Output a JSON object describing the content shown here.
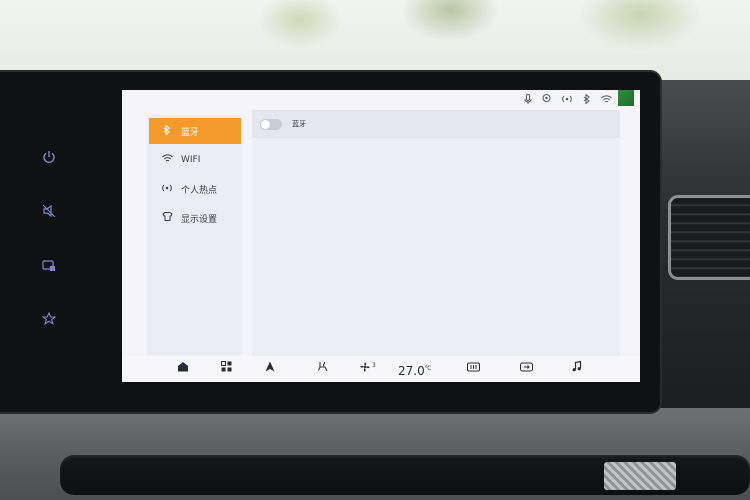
{
  "left_rail": {
    "icons": [
      "power-icon",
      "mute-icon",
      "lock-screen-icon",
      "favorite-star-icon"
    ]
  },
  "status_bar": {
    "icons": [
      "microphone-icon",
      "location-icon",
      "broadcast-icon",
      "bluetooth-icon",
      "wifi-icon"
    ]
  },
  "sidebar": {
    "items": [
      {
        "label": "蓝牙",
        "icon": "bluetooth-icon",
        "active": true
      },
      {
        "label": "WIFI",
        "icon": "wifi-icon",
        "active": false
      },
      {
        "label": "个人热点",
        "icon": "hotspot-icon",
        "active": false
      },
      {
        "label": "显示设置",
        "icon": "display-icon",
        "active": false
      }
    ]
  },
  "bluetooth_panel": {
    "toggle_label": "蓝牙",
    "toggle_on": false
  },
  "dock": {
    "temperature": "27.0",
    "temperature_unit": "℃",
    "fan_level": "3",
    "icons": [
      "home-icon",
      "apps-icon",
      "navigation-icon",
      "seat-heat-icon",
      "fan-icon",
      "rear-defrost-icon",
      "recirculation-icon",
      "music-icon"
    ]
  },
  "colors": {
    "accent": "#f29b2a",
    "screen_bg": "#f4f4fa",
    "rail_icon": "#7f86c8"
  }
}
